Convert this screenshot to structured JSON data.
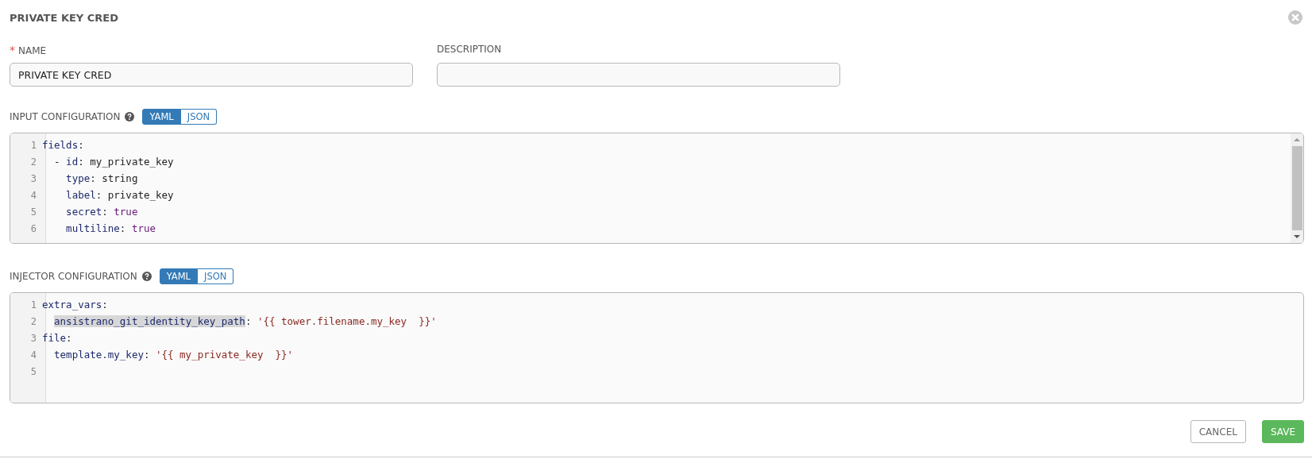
{
  "title": "PRIVATE KEY CRED",
  "name_field": {
    "label": "NAME",
    "required_mark": "*",
    "value": "PRIVATE KEY CRED"
  },
  "description_field": {
    "label": "DESCRIPTION"
  },
  "editors": [
    {
      "label": "INPUT CONFIGURATION",
      "modes": [
        {
          "label": "YAML",
          "selected": true
        },
        {
          "label": "JSON",
          "selected": false
        }
      ],
      "scrollbar": true,
      "lines": [
        {
          "number": "1",
          "tokens": [
            {
              "text": "fields",
              "kind": "key",
              "highlighted": false
            },
            {
              "text": ":",
              "kind": "plain",
              "highlighted": false
            }
          ]
        },
        {
          "number": "2",
          "tokens": [
            {
              "text": "  -",
              "kind": "plain",
              "highlighted": false
            },
            {
              "text": " id",
              "kind": "key",
              "highlighted": false
            },
            {
              "text": ": my_private_key",
              "kind": "plain",
              "highlighted": false
            }
          ]
        },
        {
          "number": "3",
          "tokens": [
            {
              "text": "    type",
              "kind": "key",
              "highlighted": false
            },
            {
              "text": ": string",
              "kind": "plain",
              "highlighted": false
            }
          ]
        },
        {
          "number": "4",
          "tokens": [
            {
              "text": "    label",
              "kind": "key",
              "highlighted": false
            },
            {
              "text": ": private_key",
              "kind": "plain",
              "highlighted": false
            }
          ]
        },
        {
          "number": "5",
          "tokens": [
            {
              "text": "    secret",
              "kind": "key",
              "highlighted": false
            },
            {
              "text": ":",
              "kind": "plain",
              "highlighted": false
            },
            {
              "text": " true",
              "kind": "atom",
              "highlighted": false
            }
          ]
        },
        {
          "number": "6",
          "tokens": [
            {
              "text": "    multiline",
              "kind": "key",
              "highlighted": false
            },
            {
              "text": ":",
              "kind": "plain",
              "highlighted": false
            },
            {
              "text": " true",
              "kind": "atom",
              "highlighted": false
            }
          ]
        }
      ]
    },
    {
      "label": "INJECTOR CONFIGURATION",
      "modes": [
        {
          "label": "YAML",
          "selected": true
        },
        {
          "label": "JSON",
          "selected": false
        }
      ],
      "lines": [
        {
          "number": "1",
          "tokens": [
            {
              "text": "extra_vars",
              "kind": "key",
              "highlighted": false
            },
            {
              "text": ":",
              "kind": "plain",
              "highlighted": false
            }
          ]
        },
        {
          "number": "2",
          "tokens": [
            {
              "text": "  ansistrano_git_identity_key_path",
              "kind": "key",
              "highlighted": true
            },
            {
              "text": ":",
              "kind": "plain",
              "highlighted": false
            },
            {
              "text": " '{{ tower.filename.my_key  }}'",
              "kind": "string",
              "highlighted": false
            }
          ]
        },
        {
          "number": "3",
          "tokens": [
            {
              "text": "file",
              "kind": "key",
              "highlighted": false
            },
            {
              "text": ":",
              "kind": "plain",
              "highlighted": false
            }
          ]
        },
        {
          "number": "4",
          "tokens": [
            {
              "text": "  template.my_key",
              "kind": "key",
              "highlighted": false
            },
            {
              "text": ":",
              "kind": "plain",
              "highlighted": false
            },
            {
              "text": " '{{ my_private_key  }}'",
              "kind": "string",
              "highlighted": false
            }
          ]
        },
        {
          "number": "5"
        }
      ]
    }
  ],
  "buttons": [
    {
      "label": "CANCEL",
      "kind": "secondary"
    },
    {
      "label": "SAVE",
      "kind": "primary"
    }
  ]
}
